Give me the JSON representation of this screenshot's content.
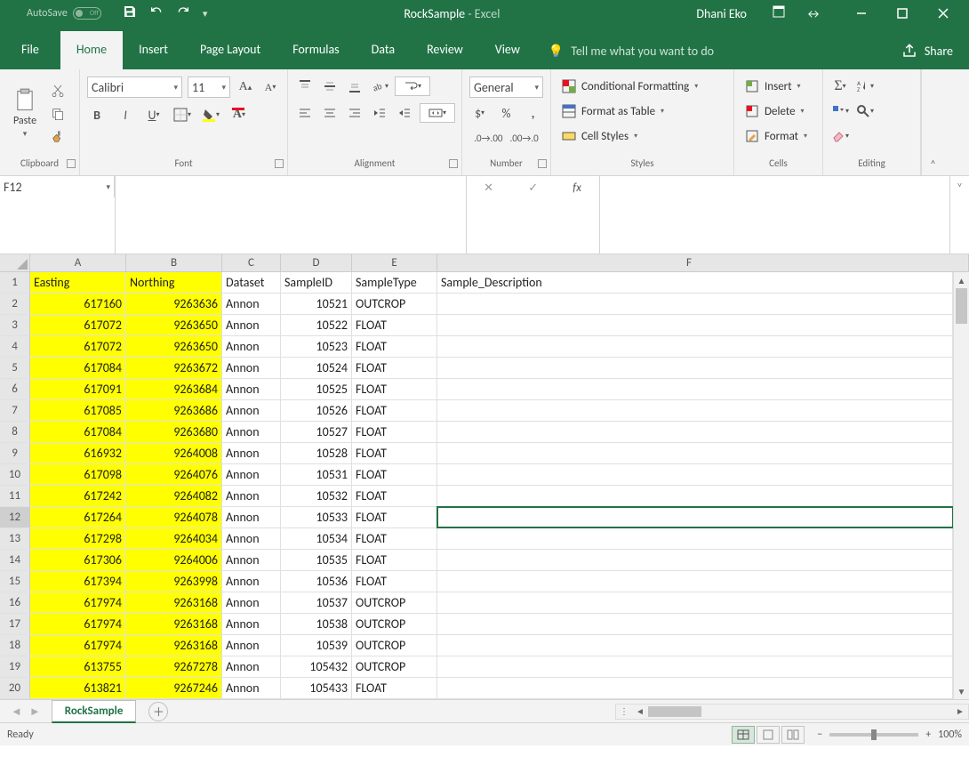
{
  "titlebar": {
    "autosave_label": "AutoSave",
    "toggle_state": "Off",
    "title": "RockSample",
    "app_sub": "  -  Excel",
    "username": "Dhani Eko"
  },
  "tabs": {
    "file": "File",
    "items": [
      "Home",
      "Insert",
      "Page Layout",
      "Formulas",
      "Data",
      "Review",
      "View"
    ],
    "active": "Home",
    "tell_me": "Tell me what you want to do",
    "share": "Share"
  },
  "ribbon": {
    "clipboard": {
      "paste": "Paste",
      "label": "Clipboard"
    },
    "font": {
      "name": "Calibri",
      "size": "11",
      "label": "Font"
    },
    "alignment": {
      "label": "Alignment"
    },
    "number": {
      "format": "General",
      "label": "Number"
    },
    "styles": {
      "cond": "Conditional Formatting",
      "table": "Format as Table",
      "cell": "Cell Styles",
      "label": "Styles"
    },
    "cells": {
      "insert": "Insert",
      "delete": "Delete",
      "format": "Format",
      "label": "Cells"
    },
    "editing": {
      "label": "Editing"
    }
  },
  "formula_bar": {
    "name_box": "F12",
    "formula": ""
  },
  "grid": {
    "columns": [
      {
        "id": "A",
        "width": "wA"
      },
      {
        "id": "B",
        "width": "wB"
      },
      {
        "id": "C",
        "width": "wC"
      },
      {
        "id": "D",
        "width": "wD"
      },
      {
        "id": "E",
        "width": "wE"
      },
      {
        "id": "F",
        "width": "last"
      }
    ],
    "header_row_labels": [
      "Easting",
      "Northing",
      "Dataset",
      "SampleID",
      "SampleType",
      "Sample_Description"
    ],
    "selected_cell": {
      "row": 12,
      "col": "F"
    },
    "rows": [
      {
        "n": 2,
        "A": "617160",
        "B": "9263636",
        "C": "Annon",
        "D": "10521",
        "E": "OUTCROP"
      },
      {
        "n": 3,
        "A": "617072",
        "B": "9263650",
        "C": "Annon",
        "D": "10522",
        "E": "FLOAT"
      },
      {
        "n": 4,
        "A": "617072",
        "B": "9263650",
        "C": "Annon",
        "D": "10523",
        "E": "FLOAT"
      },
      {
        "n": 5,
        "A": "617084",
        "B": "9263672",
        "C": "Annon",
        "D": "10524",
        "E": "FLOAT"
      },
      {
        "n": 6,
        "A": "617091",
        "B": "9263684",
        "C": "Annon",
        "D": "10525",
        "E": "FLOAT"
      },
      {
        "n": 7,
        "A": "617085",
        "B": "9263686",
        "C": "Annon",
        "D": "10526",
        "E": "FLOAT"
      },
      {
        "n": 8,
        "A": "617084",
        "B": "9263680",
        "C": "Annon",
        "D": "10527",
        "E": "FLOAT"
      },
      {
        "n": 9,
        "A": "616932",
        "B": "9264008",
        "C": "Annon",
        "D": "10528",
        "E": "FLOAT"
      },
      {
        "n": 10,
        "A": "617098",
        "B": "9264076",
        "C": "Annon",
        "D": "10531",
        "E": "FLOAT"
      },
      {
        "n": 11,
        "A": "617242",
        "B": "9264082",
        "C": "Annon",
        "D": "10532",
        "E": "FLOAT"
      },
      {
        "n": 12,
        "A": "617264",
        "B": "9264078",
        "C": "Annon",
        "D": "10533",
        "E": "FLOAT"
      },
      {
        "n": 13,
        "A": "617298",
        "B": "9264034",
        "C": "Annon",
        "D": "10534",
        "E": "FLOAT"
      },
      {
        "n": 14,
        "A": "617306",
        "B": "9264006",
        "C": "Annon",
        "D": "10535",
        "E": "FLOAT"
      },
      {
        "n": 15,
        "A": "617394",
        "B": "9263998",
        "C": "Annon",
        "D": "10536",
        "E": "FLOAT"
      },
      {
        "n": 16,
        "A": "617974",
        "B": "9263168",
        "C": "Annon",
        "D": "10537",
        "E": "OUTCROP"
      },
      {
        "n": 17,
        "A": "617974",
        "B": "9263168",
        "C": "Annon",
        "D": "10538",
        "E": "OUTCROP"
      },
      {
        "n": 18,
        "A": "617974",
        "B": "9263168",
        "C": "Annon",
        "D": "10539",
        "E": "OUTCROP"
      },
      {
        "n": 19,
        "A": "613755",
        "B": "9267278",
        "C": "Annon",
        "D": "105432",
        "E": "OUTCROP"
      },
      {
        "n": 20,
        "A": "613821",
        "B": "9267246",
        "C": "Annon",
        "D": "105433",
        "E": "FLOAT"
      }
    ]
  },
  "sheets": {
    "active": "RockSample"
  },
  "status": {
    "ready": "Ready",
    "zoom": "100%"
  }
}
